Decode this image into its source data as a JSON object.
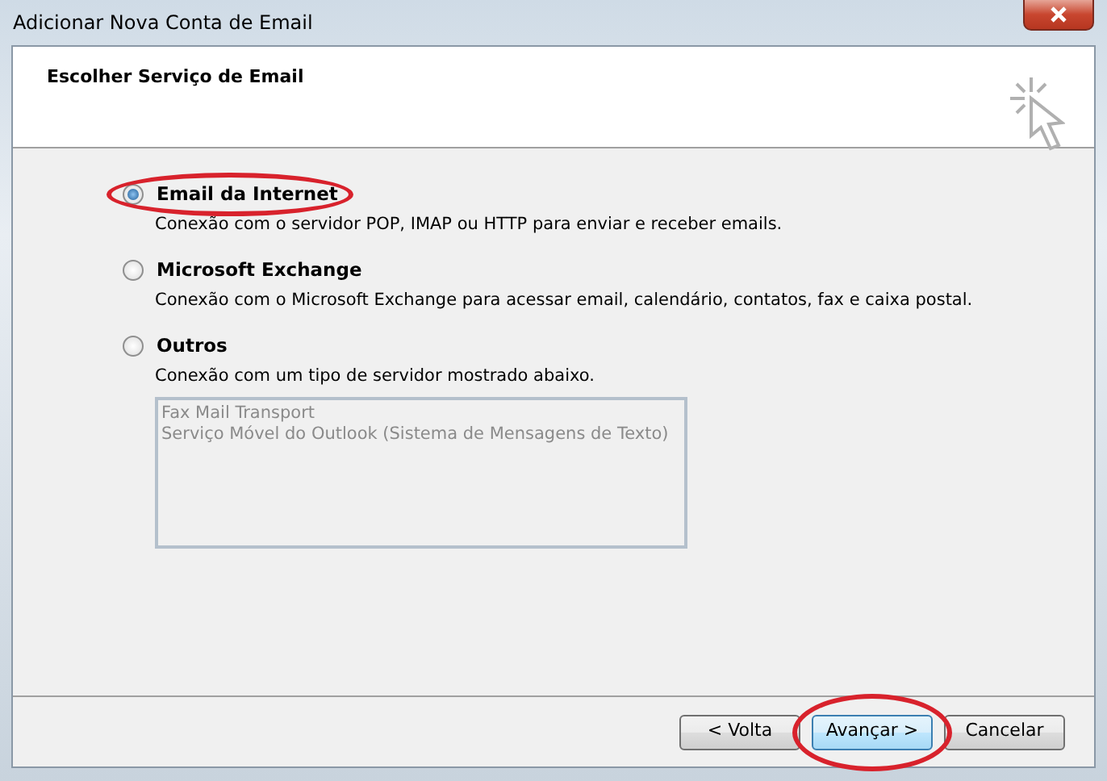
{
  "window": {
    "title": "Adicionar Nova Conta de Email"
  },
  "header": {
    "title": "Escolher Serviço de Email"
  },
  "options": [
    {
      "label": "Email da Internet",
      "description": "Conexão com o servidor POP, IMAP ou HTTP para enviar e receber emails.",
      "selected": true,
      "highlighted": true
    },
    {
      "label": "Microsoft Exchange",
      "description": "Conexão com o Microsoft Exchange para acessar email, calendário, contatos, fax e caixa postal.",
      "selected": false,
      "highlighted": false
    },
    {
      "label": "Outros",
      "description": "Conexão com um tipo de servidor mostrado abaixo.",
      "selected": false,
      "highlighted": false,
      "list": [
        "Fax Mail Transport",
        "Serviço Móvel do Outlook (Sistema de Mensagens de Texto)"
      ]
    }
  ],
  "buttons": [
    {
      "label": "< Volta",
      "kind": "default",
      "highlighted": false
    },
    {
      "label": "Avançar >",
      "kind": "primary",
      "highlighted": true
    },
    {
      "label": "Cancelar",
      "kind": "default",
      "highlighted": false
    }
  ]
}
